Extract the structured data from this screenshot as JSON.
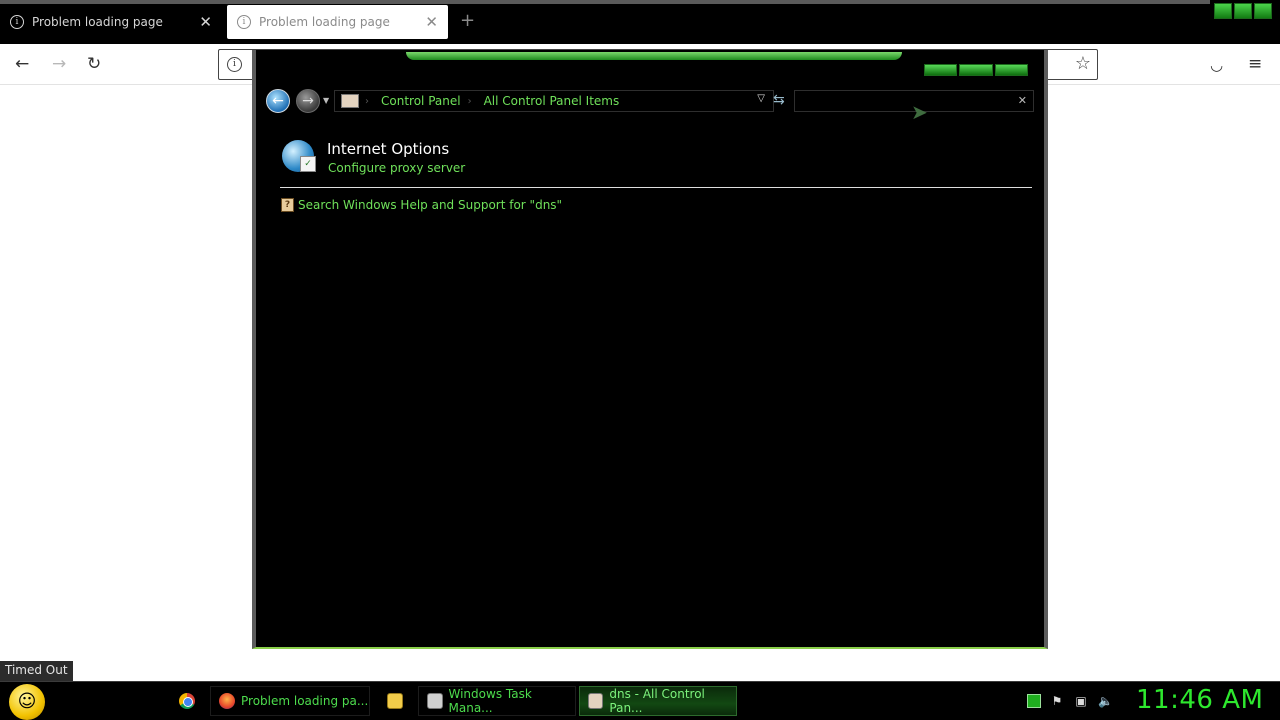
{
  "browser": {
    "tabs": [
      {
        "title": "Problem loading page",
        "active": false
      },
      {
        "title": "Problem loading page",
        "active": true
      }
    ],
    "new_tab_icon": "plus-icon",
    "status_text": "Timed Out"
  },
  "control_panel": {
    "breadcrumb": [
      "Control Panel",
      "All Control Panel Items"
    ],
    "search_value": "",
    "result": {
      "title": "Internet Options",
      "link": "Configure proxy server"
    },
    "help_link": "Search Windows Help and Support for \"dns\""
  },
  "taskbar": {
    "items": [
      {
        "label": "Problem loading pa...",
        "icon": "firefox-icon"
      },
      {
        "label": "",
        "icon": "folder-icon"
      },
      {
        "label": "Windows Task Mana...",
        "icon": "task-manager-icon"
      },
      {
        "label": "dns - All Control Pan...",
        "icon": "control-panel-icon",
        "active": true
      }
    ],
    "clock": "11:46 AM"
  },
  "colors": {
    "accent_green": "#6fe05a",
    "window_bg": "#000000",
    "clock_green": "#2ee82e"
  }
}
